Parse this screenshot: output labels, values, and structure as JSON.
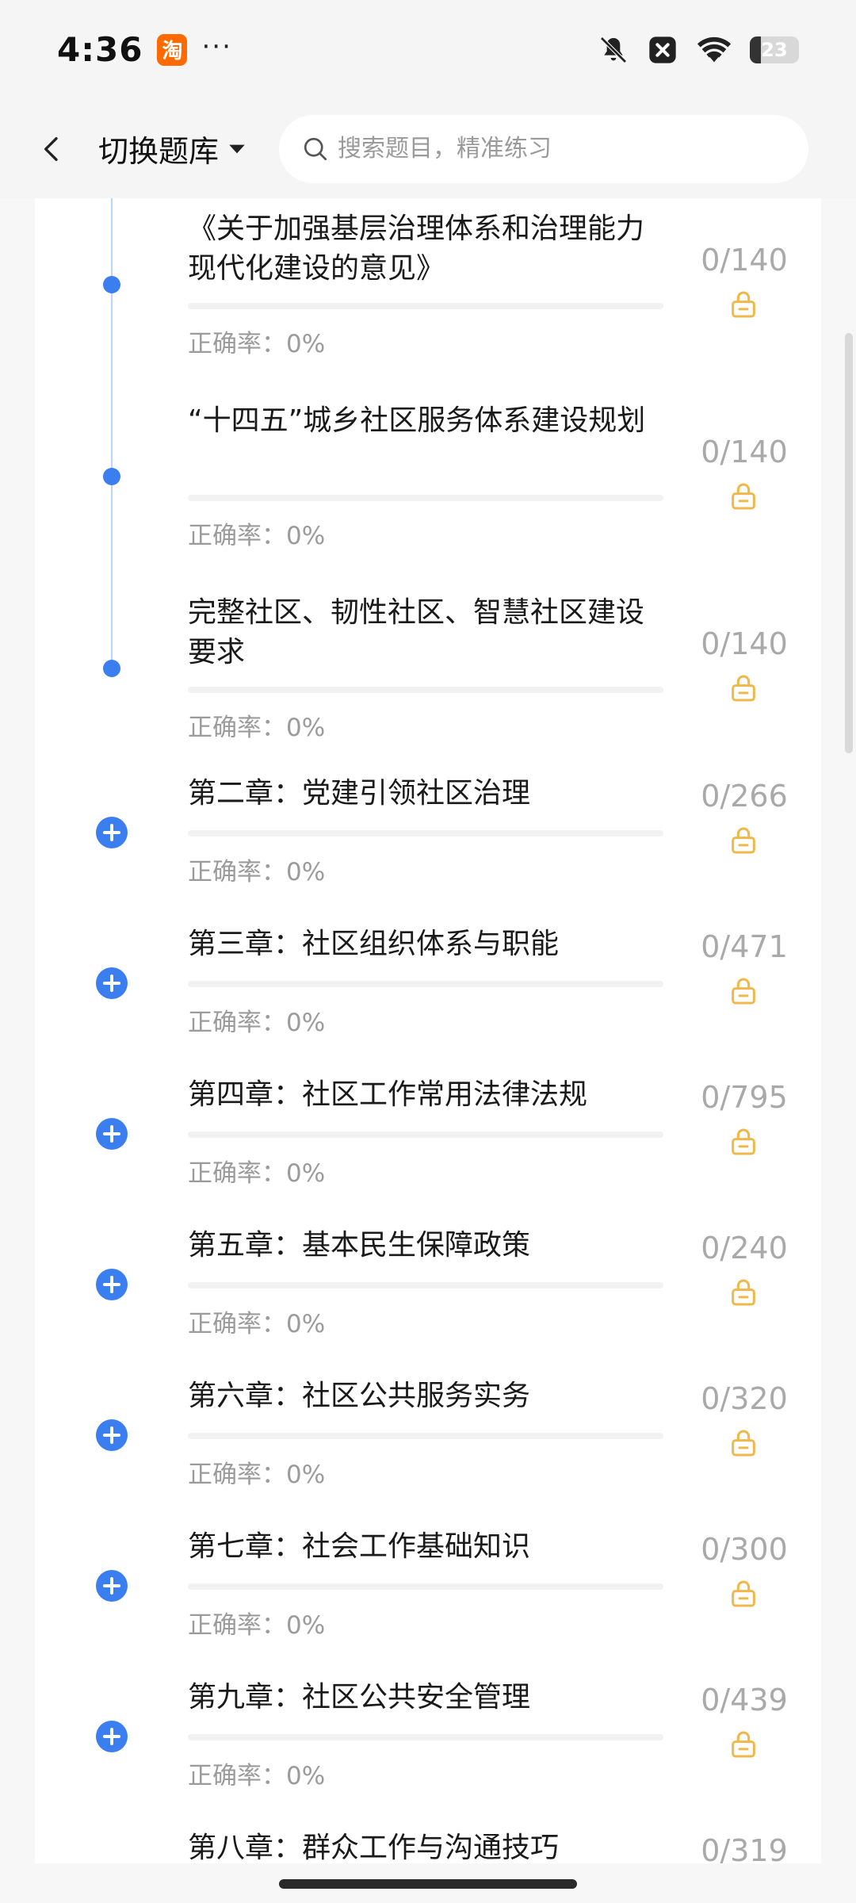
{
  "status_bar": {
    "time": "4:36",
    "app_badge": "淘",
    "more": "···",
    "battery_level": "23",
    "icons": [
      "bell-muted-icon",
      "close-box-icon",
      "wifi-icon",
      "battery-icon"
    ]
  },
  "header": {
    "bank_switch_label": "切换题库",
    "search_placeholder": "搜索题目，精准练习"
  },
  "colors": {
    "accent": "#3a7ef0",
    "lock": "#f0b84a",
    "muted_text": "#9b9b9b"
  },
  "items": [
    {
      "kind": "section",
      "title": "《关于加强基层治理体系和治理能力现代化建设的意见》",
      "accuracy": "正确率：0%",
      "count": "0/140",
      "progress": 0
    },
    {
      "kind": "section",
      "title": "“十四五”城乡社区服务体系建设规划",
      "accuracy": "正确率：0%",
      "count": "0/140",
      "progress": 0
    },
    {
      "kind": "section",
      "title": "完整社区、韧性社区、智慧社区建设要求",
      "accuracy": "正确率：0%",
      "count": "0/140",
      "progress": 0
    },
    {
      "kind": "chapter",
      "title": "第二章：党建引领社区治理",
      "accuracy": "正确率：0%",
      "count": "0/266",
      "progress": 0
    },
    {
      "kind": "chapter",
      "title": "第三章：社区组织体系与职能",
      "accuracy": "正确率：0%",
      "count": "0/471",
      "progress": 0
    },
    {
      "kind": "chapter",
      "title": "第四章：社区工作常用法律法规",
      "accuracy": "正确率：0%",
      "count": "0/795",
      "progress": 0
    },
    {
      "kind": "chapter",
      "title": "第五章：基本民生保障政策",
      "accuracy": "正确率：0%",
      "count": "0/240",
      "progress": 0
    },
    {
      "kind": "chapter",
      "title": "第六章：社区公共服务实务",
      "accuracy": "正确率：0%",
      "count": "0/320",
      "progress": 0
    },
    {
      "kind": "chapter",
      "title": "第七章：社会工作基础知识",
      "accuracy": "正确率：0%",
      "count": "0/300",
      "progress": 0
    },
    {
      "kind": "chapter",
      "title": "第九章：社区公共安全管理",
      "accuracy": "正确率：0%",
      "count": "0/439",
      "progress": 0
    },
    {
      "kind": "chapter",
      "title": "第八章：群众工作与沟通技巧",
      "accuracy": "",
      "count": "0/319",
      "progress": 0
    }
  ]
}
